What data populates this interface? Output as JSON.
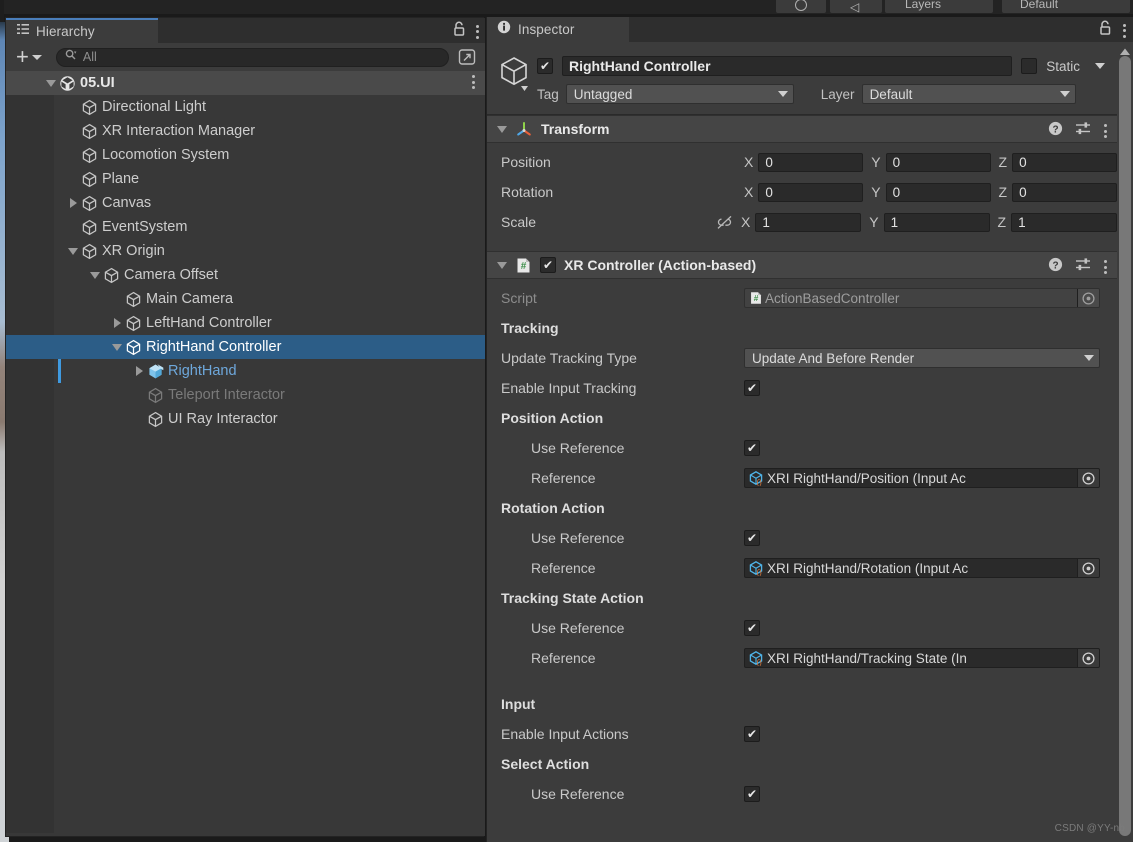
{
  "topbar": {
    "layers_label": "Layers",
    "layout_label": "Default",
    "icon_undo": "undo-icon",
    "icon_account": "account-icon"
  },
  "hierarchy": {
    "tab_label": "Hierarchy",
    "tab_icon": "hierarchy-icon",
    "lock_icon": "lock-icon",
    "menu_icon": "kebab-menu-icon",
    "add_label": "+",
    "search_placeholder": "All",
    "search_icon": "search-icon",
    "popout_icon": "popout-icon",
    "tree": [
      {
        "label": "05.UI",
        "depth": 0,
        "icon": "unity-scene-icon",
        "twisty": "down",
        "state": "scene",
        "kebab": true
      },
      {
        "label": "Directional Light",
        "depth": 1,
        "icon": "gameobject-icon",
        "twisty": "none",
        "state": "normal"
      },
      {
        "label": "XR Interaction Manager",
        "depth": 1,
        "icon": "gameobject-icon",
        "twisty": "none",
        "state": "normal"
      },
      {
        "label": "Locomotion System",
        "depth": 1,
        "icon": "gameobject-icon",
        "twisty": "none",
        "state": "normal"
      },
      {
        "label": "Plane",
        "depth": 1,
        "icon": "gameobject-icon",
        "twisty": "none",
        "state": "normal"
      },
      {
        "label": "Canvas",
        "depth": 1,
        "icon": "gameobject-icon",
        "twisty": "right",
        "state": "normal"
      },
      {
        "label": "EventSystem",
        "depth": 1,
        "icon": "gameobject-icon",
        "twisty": "none",
        "state": "normal"
      },
      {
        "label": "XR Origin",
        "depth": 1,
        "icon": "gameobject-icon",
        "twisty": "down",
        "state": "normal"
      },
      {
        "label": "Camera Offset",
        "depth": 2,
        "icon": "gameobject-icon",
        "twisty": "down",
        "state": "normal"
      },
      {
        "label": "Main Camera",
        "depth": 3,
        "icon": "gameobject-icon",
        "twisty": "none",
        "state": "normal"
      },
      {
        "label": "LeftHand Controller",
        "depth": 3,
        "icon": "gameobject-icon",
        "twisty": "right",
        "state": "normal"
      },
      {
        "label": "RightHand Controller",
        "depth": 3,
        "icon": "gameobject-icon",
        "twisty": "down",
        "state": "selected"
      },
      {
        "label": "RightHand",
        "depth": 4,
        "icon": "prefab-icon",
        "twisty": "right",
        "state": "prefab"
      },
      {
        "label": "Teleport Interactor",
        "depth": 4,
        "icon": "gameobject-icon",
        "twisty": "none",
        "state": "disabled"
      },
      {
        "label": "UI Ray Interactor",
        "depth": 4,
        "icon": "gameobject-icon",
        "twisty": "none",
        "state": "normal"
      }
    ]
  },
  "inspector": {
    "tab_label": "Inspector",
    "tab_icon": "info-icon",
    "lock_icon": "lock-icon",
    "menu_icon": "kebab-menu-icon",
    "gameobject": {
      "icon": "gameobject-icon",
      "enabled": true,
      "name": "RightHand Controller",
      "static_checked": false,
      "static_label": "Static",
      "tag_label": "Tag",
      "tag_value": "Untagged",
      "layer_label": "Layer",
      "layer_value": "Default"
    },
    "components": [
      {
        "title": "Transform",
        "icon": "transform-icon",
        "expanded": true,
        "has_enable_toggle": false,
        "help_icon": "help-icon",
        "preset_icon": "preset-icon",
        "menu_icon": "kebab-menu-icon",
        "rows": [
          {
            "type": "vector3",
            "label": "Position",
            "x": "0",
            "y": "0",
            "z": "0",
            "axes": [
              "X",
              "Y",
              "Z"
            ]
          },
          {
            "type": "vector3",
            "label": "Rotation",
            "x": "0",
            "y": "0",
            "z": "0",
            "axes": [
              "X",
              "Y",
              "Z"
            ]
          },
          {
            "type": "vector3",
            "label": "Scale",
            "x": "1",
            "y": "1",
            "z": "1",
            "axes": [
              "X",
              "Y",
              "Z"
            ],
            "link_icon": "constrain-proportions-off-icon"
          }
        ]
      },
      {
        "title": "XR Controller (Action-based)",
        "icon": "script-icon",
        "expanded": true,
        "has_enable_toggle": true,
        "enabled": true,
        "help_icon": "help-icon",
        "preset_icon": "preset-icon",
        "menu_icon": "kebab-menu-icon",
        "rows": [
          {
            "type": "object",
            "label": "Script",
            "value": "ActionBasedController",
            "dim": true,
            "icon": "script-icon"
          },
          {
            "type": "header",
            "label": "Tracking"
          },
          {
            "type": "dropdown",
            "label": "Update Tracking Type",
            "value": "Update And Before Render"
          },
          {
            "type": "checkbox",
            "label": "Enable Input Tracking",
            "checked": true
          },
          {
            "type": "header",
            "label": "Position Action"
          },
          {
            "type": "checkbox",
            "label": "Use Reference",
            "checked": true,
            "indent": true
          },
          {
            "type": "object",
            "label": "Reference",
            "value": "XRI RightHand/Position (Input Ac",
            "indent": true,
            "icon": "input-action-icon"
          },
          {
            "type": "header",
            "label": "Rotation Action"
          },
          {
            "type": "checkbox",
            "label": "Use Reference",
            "checked": true,
            "indent": true
          },
          {
            "type": "object",
            "label": "Reference",
            "value": "XRI RightHand/Rotation (Input Ac",
            "indent": true,
            "icon": "input-action-icon"
          },
          {
            "type": "header",
            "label": "Tracking State Action"
          },
          {
            "type": "checkbox",
            "label": "Use Reference",
            "checked": true,
            "indent": true
          },
          {
            "type": "object",
            "label": "Reference",
            "value": "XRI RightHand/Tracking State (In",
            "indent": true,
            "icon": "input-action-icon"
          },
          {
            "type": "spacer"
          },
          {
            "type": "header",
            "label": "Input"
          },
          {
            "type": "checkbox",
            "label": "Enable Input Actions",
            "checked": true
          },
          {
            "type": "header",
            "label": "Select Action"
          },
          {
            "type": "checkbox",
            "label": "Use Reference",
            "checked": true,
            "indent": true
          }
        ]
      }
    ]
  },
  "watermark": "CSDN @YY-nb",
  "colors": {
    "selection_blue": "#2c5d87",
    "prefab_blue": "#6ea8dc",
    "tab_accent": "#4a7ebb",
    "panel_bg": "#3c3c3c"
  }
}
